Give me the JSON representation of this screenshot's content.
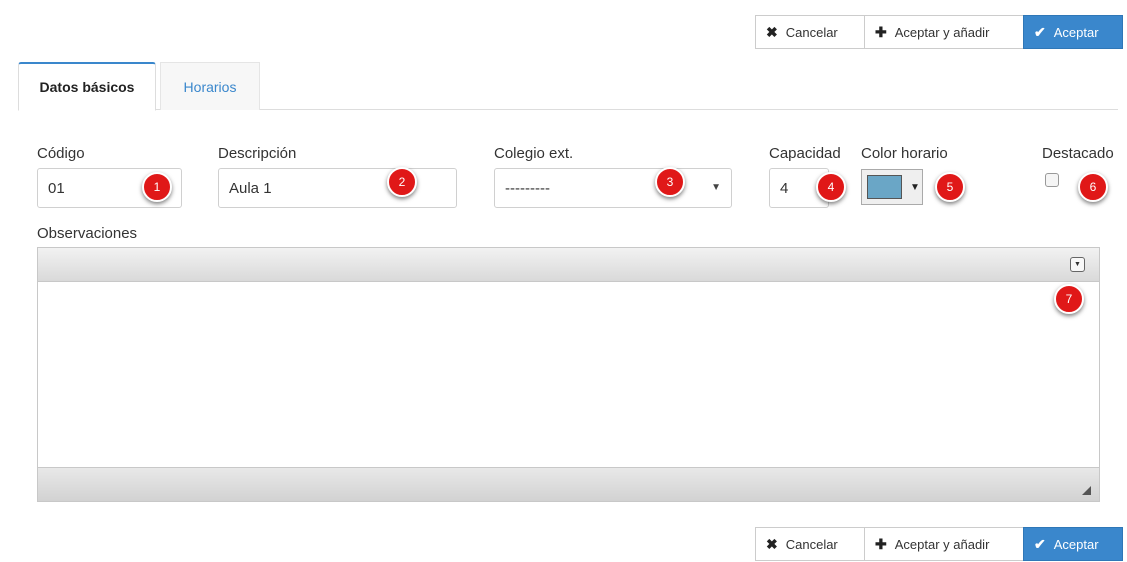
{
  "toolbar": {
    "cancel_label": "Cancelar",
    "cancel_icon": "✖",
    "accept_add_label": "Aceptar y añadir",
    "accept_add_icon": "✚",
    "accept_label": "Aceptar",
    "accept_icon": "✔"
  },
  "tabs": [
    {
      "label": "Datos básicos",
      "active": true
    },
    {
      "label": "Horarios",
      "active": false
    }
  ],
  "form": {
    "codigo": {
      "label": "Código",
      "value": "01",
      "badge": "1"
    },
    "descripcion": {
      "label": "Descripción",
      "value": "Aula 1",
      "badge": "2"
    },
    "colegio": {
      "label": "Colegio ext.",
      "value": "---------",
      "badge": "3"
    },
    "capacidad": {
      "label": "Capacidad",
      "value": "4",
      "badge": "4"
    },
    "color_horario": {
      "label": "Color horario",
      "value_color": "#6aa6c6",
      "badge": "5"
    },
    "destacado": {
      "label": "Destacado",
      "checked": false,
      "badge": "6"
    },
    "observaciones": {
      "label": "Observaciones",
      "value": "",
      "badge": "7"
    }
  },
  "colors": {
    "accent": "#3a87cc",
    "badge": "#e01818"
  }
}
